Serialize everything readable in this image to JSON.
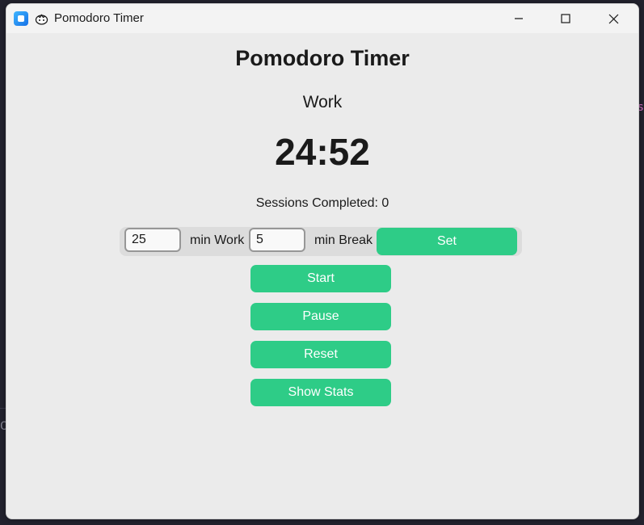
{
  "window": {
    "title": "Pomodoro Timer",
    "controls": [
      "minimize",
      "maximize",
      "close"
    ]
  },
  "app": {
    "heading": "Pomodoro Timer",
    "mode": "Work",
    "time": "24:52",
    "sessions_text": "Sessions Completed: 0"
  },
  "settings": {
    "work_minutes": "25",
    "work_label": "min Work",
    "break_minutes": "5",
    "break_label": "min Break",
    "set_label": "Set"
  },
  "buttons": {
    "start": "Start",
    "pause": "Pause",
    "reset": "Reset",
    "stats": "Show Stats"
  },
  "colors": {
    "accent": "#2ecc87",
    "window_bg": "#ebebeb",
    "titlebar_bg": "#f3f3f3"
  },
  "icons": {
    "app": "app-logo-icon",
    "tomato": "tomato-icon"
  }
}
